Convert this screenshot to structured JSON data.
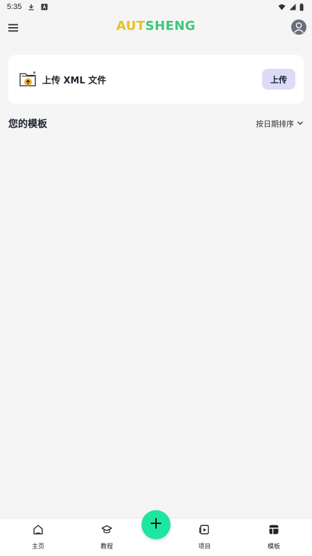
{
  "status_bar": {
    "time": "5:35",
    "icons": [
      "download-icon",
      "text-a-icon",
      "wifi-icon",
      "signal-icon",
      "battery-icon"
    ]
  },
  "app_bar": {
    "logo_part1": "AUT",
    "logo_part2": "SHENG",
    "icons": [
      "menu-icon",
      "account-icon"
    ]
  },
  "upload_card": {
    "label": "上传 XML 文件",
    "button_label": "上传",
    "icon": "folder-upload-icon"
  },
  "templates": {
    "title": "您的模板",
    "sort_label": "按日期排序",
    "items": []
  },
  "bottom_nav": {
    "items": [
      {
        "label": "主页",
        "icon": "home-icon"
      },
      {
        "label": "教程",
        "icon": "graduation-cap-icon"
      },
      {
        "label": "项目",
        "icon": "project-icon"
      },
      {
        "label": "模板",
        "icon": "template-icon",
        "active": true
      }
    ],
    "fab_icon": "plus-icon"
  },
  "colors": {
    "background": "#f5f5f5",
    "card": "#ffffff",
    "upload_button": "#dcdcf8",
    "fab": "#1ee6a0",
    "logo_yellow": "#e7c21e",
    "logo_green": "#39c97a"
  }
}
